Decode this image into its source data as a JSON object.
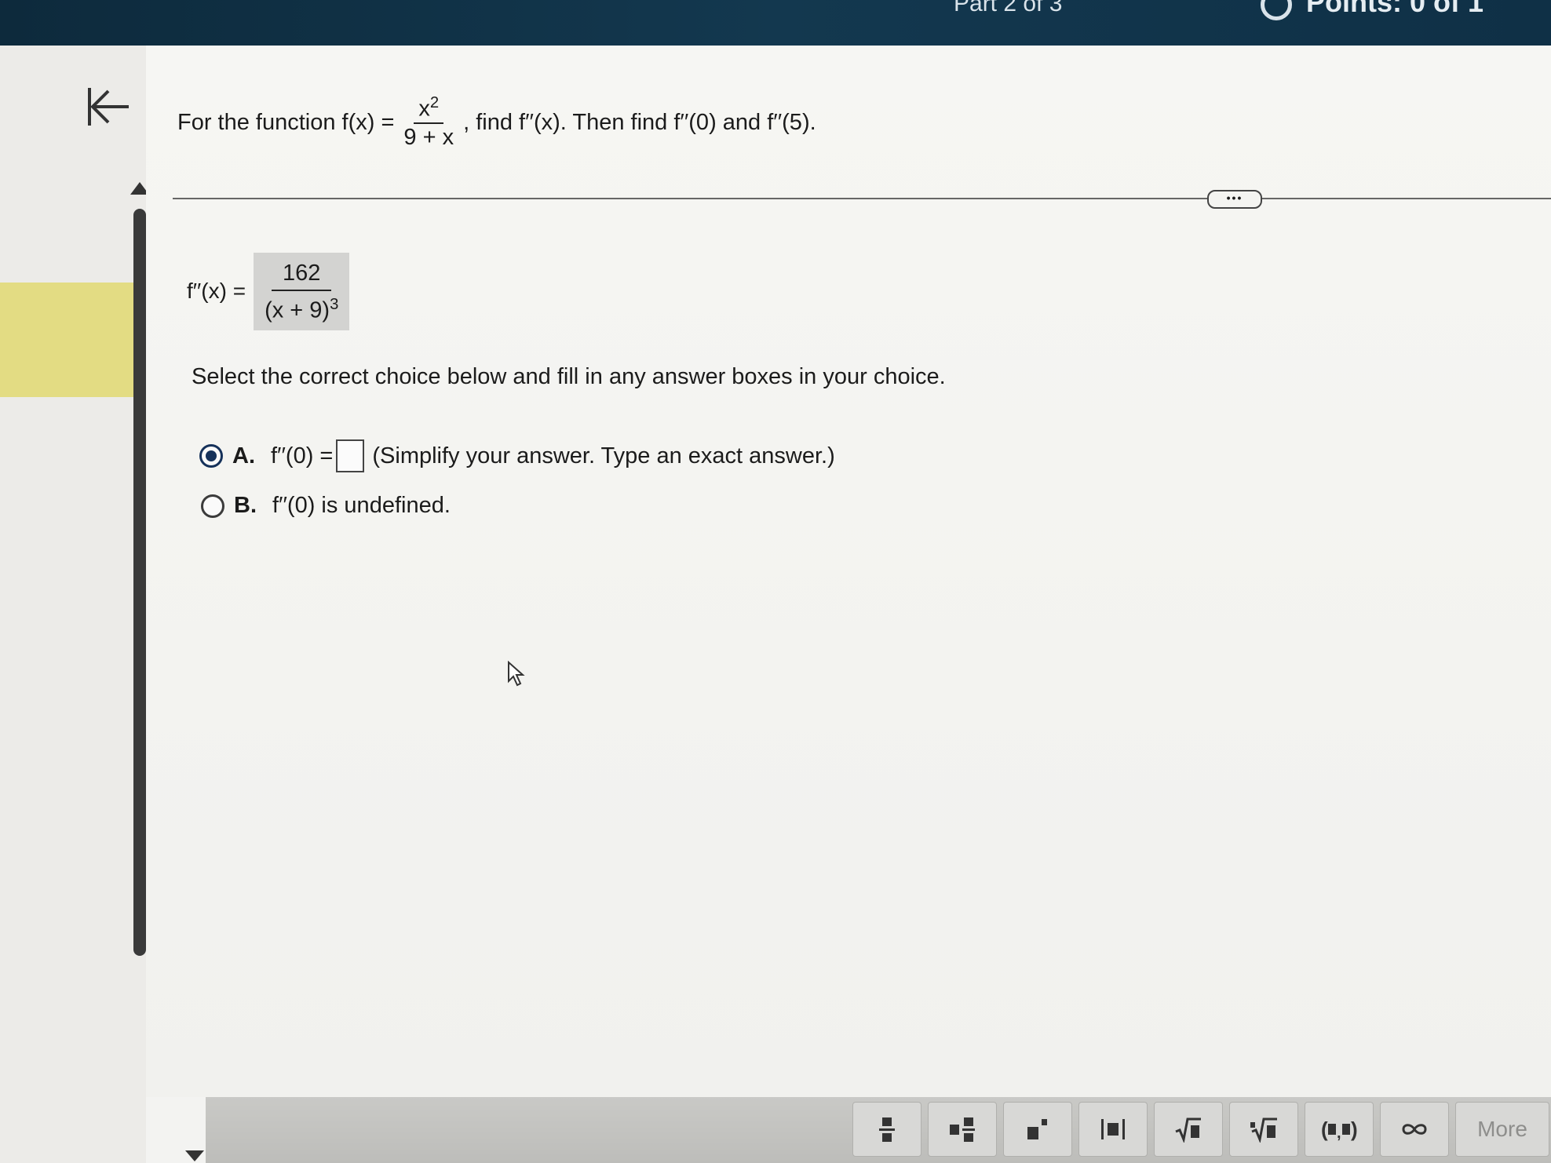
{
  "header": {
    "part_label": "Part 2 of 3",
    "points_label": "Points: 0 of 1"
  },
  "question": {
    "prefix": "For the function f(x) =",
    "numerator": "x",
    "numerator_exponent": "2",
    "denominator": "9 + x",
    "suffix": ", find f′′(x). Then find f′′(0) and f′′(5)."
  },
  "more_button_label": "•••",
  "answer": {
    "lhs": "f′′(x) =",
    "numerator": "162",
    "denominator": "(x + 9)",
    "denominator_exponent": "3"
  },
  "instruction": "Select the correct choice below and fill in any answer boxes in your choice.",
  "choices": [
    {
      "letter": "A.",
      "prefix": "f′′(0) =",
      "hint": "(Simplify your answer. Type an exact answer.)",
      "selected": true
    },
    {
      "letter": "B.",
      "text": "f′′(0) is undefined.",
      "selected": false
    }
  ],
  "toolbar": {
    "buttons": [
      {
        "icon": "fraction-icon",
        "glyph": "▪̶▪"
      },
      {
        "icon": "mixed-number-icon",
        "glyph": "▪▪"
      },
      {
        "icon": "exponent-icon",
        "glyph": "▪▪"
      },
      {
        "icon": "absolute-value-icon",
        "glyph": "|▪|"
      },
      {
        "icon": "square-root-icon",
        "glyph": "√▪"
      },
      {
        "icon": "nth-root-icon",
        "glyph": "∛▪"
      },
      {
        "icon": "ordered-pair-icon",
        "glyph": "(▪,▪)"
      },
      {
        "icon": "infinity-icon",
        "glyph": "∞"
      }
    ],
    "more_label": "More"
  }
}
